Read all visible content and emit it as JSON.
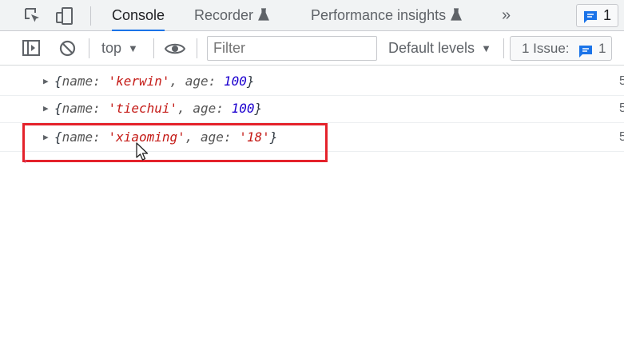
{
  "tabbar": {
    "tabs": [
      {
        "label": "Console",
        "active": true
      },
      {
        "label": "Recorder"
      },
      {
        "label": "Performance insights"
      }
    ],
    "more_label": "»",
    "issues_count": "1"
  },
  "toolbar": {
    "context": "top",
    "filter_placeholder": "Filter",
    "levels_label": "Default levels",
    "issues_label": "1 Issue:",
    "issues_count": "1"
  },
  "console": {
    "rows": [
      {
        "open": "{",
        "k1": "name",
        "v1": "'kerwin'",
        "k2": "age",
        "v2": "100",
        "close": "}",
        "v2_type": "number",
        "source": "5"
      },
      {
        "open": "{",
        "k1": "name",
        "v1": "'tiechui'",
        "k2": "age",
        "v2": "100",
        "close": "}",
        "v2_type": "number",
        "source": "5"
      },
      {
        "open": "{",
        "k1": "name",
        "v1": "'xiaoming'",
        "k2": "age",
        "v2": "'18'",
        "close": "}",
        "v2_type": "string",
        "source": "5"
      }
    ]
  },
  "colors": {
    "string": "#c41a16",
    "number": "#1c00cf",
    "highlight_box": "#e4222b",
    "accent": "#1a73e8"
  },
  "icons": [
    "inspect-element-icon",
    "device-toolbar-icon",
    "flask-icon",
    "message-icon",
    "sidebar-toggle-icon",
    "clear-console-icon",
    "eye-icon",
    "cursor-icon"
  ]
}
